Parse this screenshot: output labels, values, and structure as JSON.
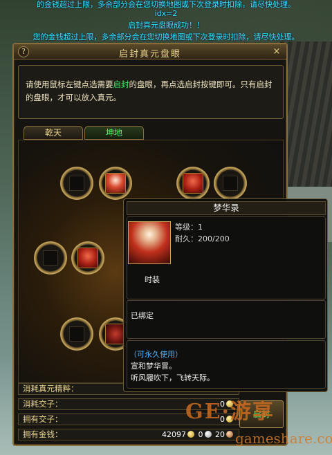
{
  "system_messages": [
    {
      "text": "的金钱超过上限，多余部分会在您切换地图或下次登录时扣除，请尽快处理。",
      "color": "cyan"
    },
    {
      "text": "idx=2",
      "color": "cyan"
    },
    {
      "text": "启封真元盘眼成功！！",
      "color": "cyan"
    },
    {
      "text": "您的金钱超过上限，多余部分会在您切换地图或下次登录时扣除，请尽快处理。",
      "color": "cyan"
    }
  ],
  "window": {
    "title": "启封真元盘眼",
    "help": "?",
    "close": "×"
  },
  "instructions": {
    "part1": "请使用鼠标左键点选需要",
    "highlight": "启封",
    "part2": "的盘眼，再点选启封按键即可。只有启封的盘眼，才可以放入真元。"
  },
  "tabs": [
    {
      "label": "乾天"
    },
    {
      "label": "坤地"
    }
  ],
  "stats": {
    "consume_essence": {
      "label": "消耗真元精粹：",
      "value": ""
    },
    "consume_jiaozi": {
      "label": "消耗交子：",
      "value": "0"
    },
    "own_jiaozi": {
      "label": "拥有交子：",
      "value": "0"
    },
    "own_money": {
      "label": "拥有金钱：",
      "gold": "42097",
      "silver": "0",
      "copper": "20"
    }
  },
  "unseal_button": {
    "label": "启封"
  },
  "tooltip": {
    "name": "梦华录",
    "level": "等级：1",
    "durability": "耐久：200/200",
    "category": "时装",
    "bind": "已绑定",
    "usage": "（可永久使用）",
    "desc_line1": "宣和梦华冒。",
    "desc_line2": "听风履吹下，飞转天际。"
  },
  "watermark": {
    "brand": "GE·游享",
    "site": "gameshare.com"
  },
  "colors": {
    "system_cyan": "#32e6ff",
    "highlight_green": "#3ee86a",
    "frame_gold": "#8a6d3b",
    "tooltip_blue": "#4fb2ff"
  }
}
